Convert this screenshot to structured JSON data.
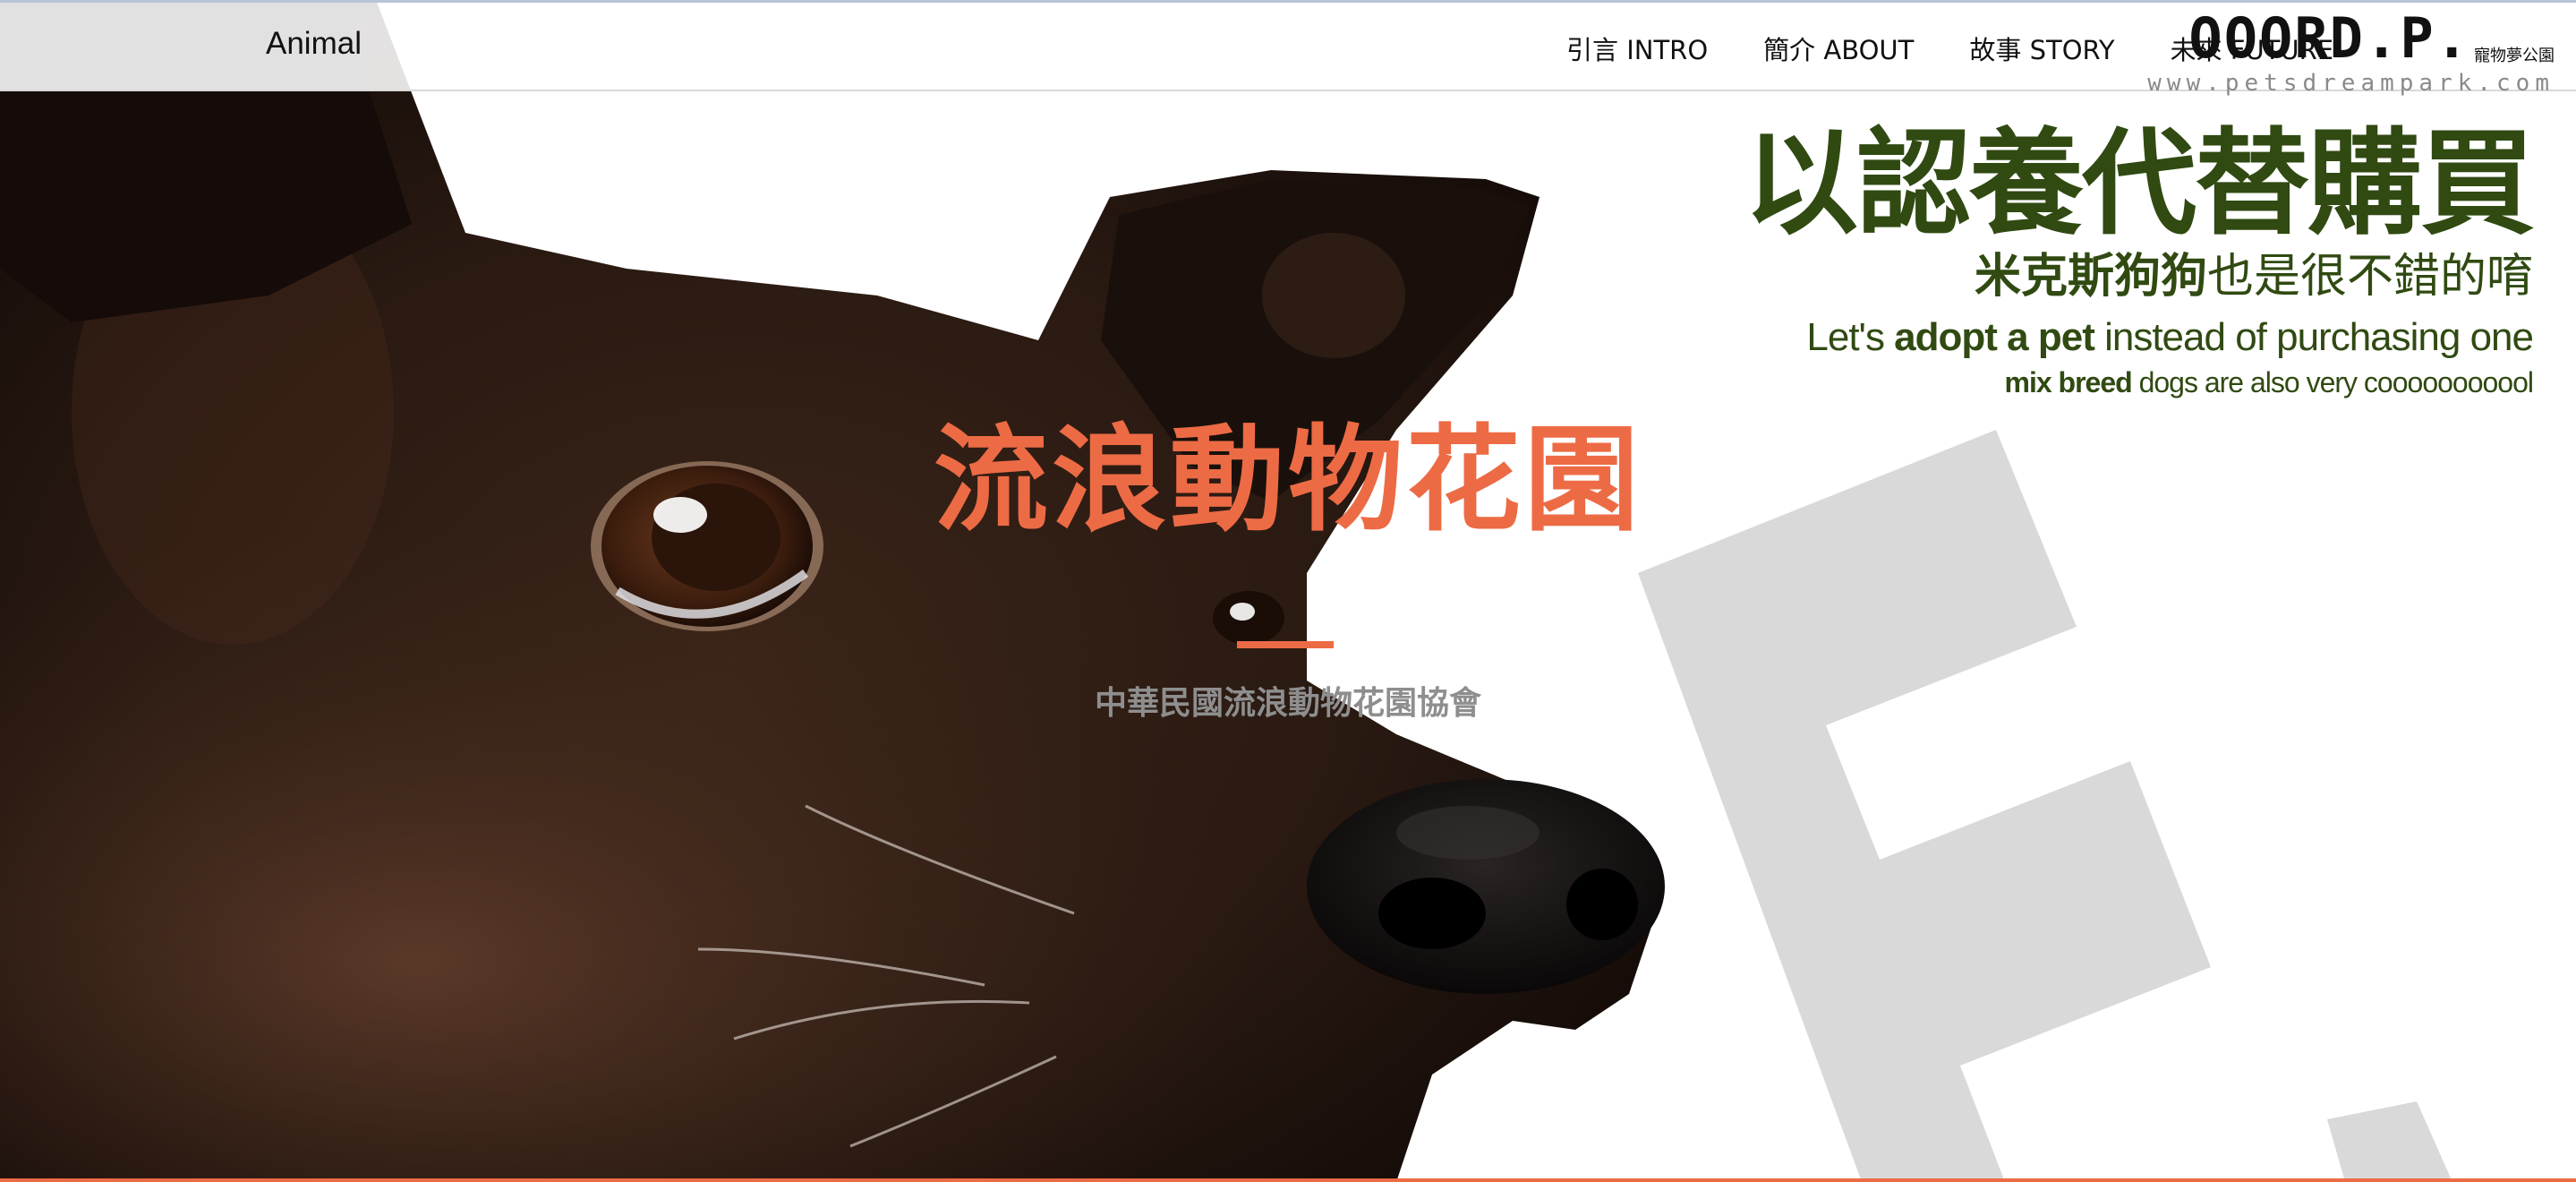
{
  "header": {
    "brand": "Animal",
    "nav": [
      {
        "label": "引言 INTRO"
      },
      {
        "label": "簡介 ABOUT"
      },
      {
        "label": "故事 STORY"
      },
      {
        "label": "未來 FUTURE"
      }
    ]
  },
  "watermark": {
    "logo_text": "OOORD.P.",
    "logo_cn": "寵物夢公園",
    "url": "www.petsdreampark.com"
  },
  "promo": {
    "headline": "以認養代替購買",
    "sub_cn_bold": "米克斯狗狗",
    "sub_cn_rest": "也是很不錯的唷",
    "en1_pre": "Let's ",
    "en1_bold": "adopt a pet",
    "en1_post": " instead of purchasing one",
    "en2_bold": "mix breed",
    "en2_rest": " dogs are also very cooooooooool"
  },
  "hero": {
    "title": "流浪動物花園",
    "subtitle": "中華民國流浪動物花園協會"
  },
  "colors": {
    "accent": "#ec6b45",
    "promo_green": "#304a12",
    "subtitle_gray": "#8e8e8e",
    "watermark_gray": "#d9d9d9"
  }
}
